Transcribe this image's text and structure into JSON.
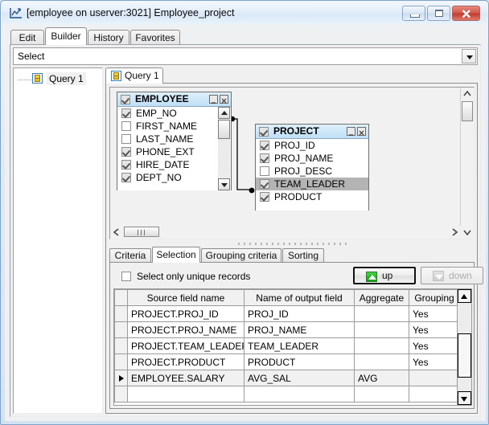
{
  "window": {
    "title": "[employee on userver:3021] Employee_project",
    "icon": "query-builder-icon",
    "buttons": {
      "minimize": "minimize-icon",
      "maximize": "maximize-icon",
      "close": "close-icon"
    }
  },
  "tabs": [
    {
      "label": "Edit",
      "active": false
    },
    {
      "label": "Builder",
      "active": true
    },
    {
      "label": "History",
      "active": false
    },
    {
      "label": "Favorites",
      "active": false
    }
  ],
  "statement_combo": {
    "value": "Select",
    "arrow": "chevron-down-icon"
  },
  "tree": {
    "item": "Query 1",
    "icon": "database-object-icon"
  },
  "query_tab": {
    "label": "Query 1",
    "icon": "database-object-icon"
  },
  "diagram": {
    "tables": [
      {
        "name": "EMPLOYEE",
        "checked": true,
        "fields": [
          {
            "name": "EMP_NO",
            "checked": true,
            "selected": false
          },
          {
            "name": "FIRST_NAME",
            "checked": false,
            "selected": false
          },
          {
            "name": "LAST_NAME",
            "checked": false,
            "selected": false
          },
          {
            "name": "PHONE_EXT",
            "checked": true,
            "selected": false
          },
          {
            "name": "HIRE_DATE",
            "checked": true,
            "selected": false
          },
          {
            "name": "DEPT_NO",
            "checked": true,
            "selected": false
          }
        ]
      },
      {
        "name": "PROJECT",
        "checked": true,
        "fields": [
          {
            "name": "PROJ_ID",
            "checked": true,
            "selected": false
          },
          {
            "name": "PROJ_NAME",
            "checked": true,
            "selected": false
          },
          {
            "name": "PROJ_DESC",
            "checked": false,
            "selected": false
          },
          {
            "name": "TEAM_LEADER",
            "checked": true,
            "selected": true
          },
          {
            "name": "PRODUCT",
            "checked": true,
            "selected": false
          }
        ]
      }
    ],
    "join_link": "join-line"
  },
  "lower_tabs": [
    {
      "label": "Criteria",
      "active": false
    },
    {
      "label": "Selection",
      "active": true
    },
    {
      "label": "Grouping criteria",
      "active": false
    },
    {
      "label": "Sorting",
      "active": false
    }
  ],
  "options": {
    "unique_records_label": "Select only unique records",
    "unique_records_checked": false
  },
  "buttons": {
    "up": {
      "label": "up",
      "icon": "arrow-up-icon",
      "enabled": true,
      "focused": true
    },
    "down": {
      "label": "down",
      "icon": "arrow-down-icon",
      "enabled": false,
      "focused": false
    }
  },
  "grid": {
    "columns": [
      "Source field name",
      "Name of output field",
      "Aggregate",
      "Grouping"
    ],
    "rows": [
      {
        "current": false,
        "cells": [
          "PROJECT.PROJ_ID",
          "PROJ_ID",
          "",
          "Yes"
        ]
      },
      {
        "current": false,
        "cells": [
          "PROJECT.PROJ_NAME",
          "PROJ_NAME",
          "",
          "Yes"
        ]
      },
      {
        "current": false,
        "cells": [
          "PROJECT.TEAM_LEADER",
          "TEAM_LEADER",
          "",
          "Yes"
        ]
      },
      {
        "current": false,
        "cells": [
          "PROJECT.PRODUCT",
          "PRODUCT",
          "",
          "Yes"
        ]
      },
      {
        "current": true,
        "cells": [
          "EMPLOYEE.SALARY",
          "AVG_SAL",
          "AVG",
          ""
        ]
      },
      {
        "current": false,
        "cells": [
          "",
          "",
          "",
          ""
        ]
      }
    ]
  },
  "colors": {
    "title_accent": "#d35a4c",
    "table_header": "#bfdff5",
    "selection_gray": "#b4b4b4",
    "up_icon_green": "#0aa00c"
  }
}
